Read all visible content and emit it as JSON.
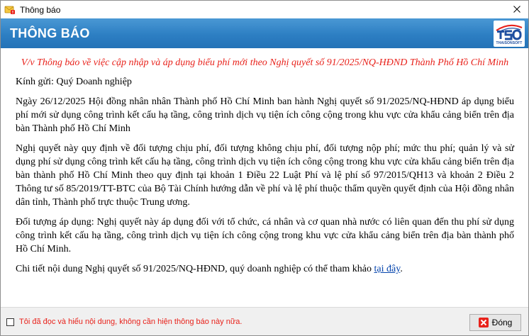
{
  "window": {
    "title": "Thông báo",
    "app_icon": "notification-icon",
    "close_icon": "close-icon"
  },
  "header": {
    "heading": "THÔNG BÁO",
    "logo_text": "THAISONSOFT",
    "colors": {
      "band_top": "#4a98d4",
      "band_bottom": "#2472b7",
      "logo_red": "#e8221b",
      "logo_blue": "#1f4fa0"
    }
  },
  "content": {
    "subject": "V/v Thông báo về việc cập nhập và áp dụng biểu phí mới theo Nghị quyết số 91/2025/NQ-HĐND Thành Phố Hồ Chí Minh",
    "greeting": "Kính gửi: Quý Doanh nghiệp",
    "paragraph_1": "Ngày 26/12/2025 Hội đồng nhân nhân Thành phố Hồ Chí Minh ban hành Nghị quyết số 91/2025/NQ-HĐND áp dụng biểu phí mới sử dụng công trình kết cấu hạ tầng, công trình dịch vụ tiện ích công cộng trong khu vực cửa khẩu cảng biển trên địa bàn Thành phố Hồ Chí Minh",
    "paragraph_2": "Nghị quyết này quy định về đối tượng chịu phí, đối tượng không chịu phí, đối tượng nộp phí; mức thu phí; quản lý và sử dụng phí sử dụng công trình kết cấu hạ tầng, công trình dịch vụ tiện ích công cộng trong khu vực cửa khẩu cảng biển trên địa bàn thành phố Hồ Chí Minh theo quy định tại khoản 1 Điều 22 Luật Phí và lệ phí số 97/2015/QH13 và khoản 2 Điều 2 Thông tư số 85/2019/TT-BTC của Bộ Tài Chính hướng dẫn về phí và lệ phí thuộc thẩm quyền quyết định của Hội đồng nhân dân tỉnh, Thành phố trực thuộc Trung ương.",
    "paragraph_3": "Đối tượng áp dụng: Nghị quyết này áp dụng đối với tổ chức, cá nhân và cơ quan nhà nước có liên quan đến thu phí sử dụng công trình kết cấu hạ tầng, công trình dịch vụ tiện ích công cộng trong khu vực cửa khẩu cảng biển trên địa bàn thành phố Hồ Chí Minh.",
    "paragraph_4_prefix": "Chi tiết nội dung Nghị quyết số 91/2025/NQ-HĐND, quý doanh nghiệp có thể tham khảo ",
    "paragraph_4_link": "tại đây",
    "paragraph_4_suffix": ".",
    "colors": {
      "subject": "#e8221b",
      "link": "#0645ad"
    }
  },
  "footer": {
    "checkbox_label": "Tôi đã đọc và hiểu nội dung, không cần hiện thông báo này nữa.",
    "checkbox_checked": false,
    "close_button_label": "Đóng",
    "close_button_icon": "close-x-icon"
  }
}
